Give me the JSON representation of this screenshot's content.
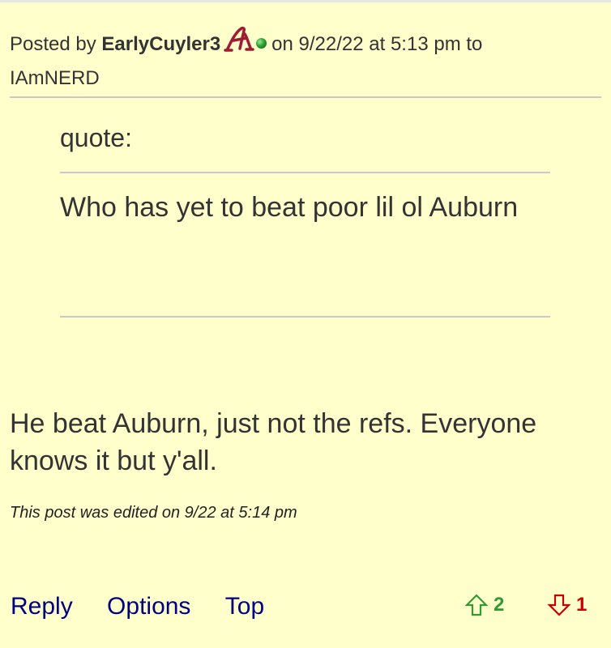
{
  "post": {
    "posted_by_label": "Posted by",
    "author": "EarlyCuyler3",
    "team_logo_letter": "A",
    "date_text": "on 9/22/22 at 5:13 pm to",
    "reply_to": "IAmNERD",
    "online_status_color": "#2ea02e",
    "quote": {
      "label": "quote:",
      "text": "Who has yet to beat poor lil ol Auburn"
    },
    "body": "He beat Auburn, just not the refs. Everyone knows it but y'all.",
    "edit_note": "This post was edited on 9/22 at 5:14 pm"
  },
  "actions": {
    "reply": "Reply",
    "options": "Options",
    "top": "Top"
  },
  "votes": {
    "up_count": "2",
    "down_count": "1",
    "up_color": "#339933",
    "down_color": "#cc0000",
    "up_icon": "arrow-up-outline-icon",
    "down_icon": "arrow-down-outline-icon"
  },
  "colors": {
    "background": "#ffffcc",
    "link": "#000080",
    "logo_crimson": "#9e1b32"
  }
}
